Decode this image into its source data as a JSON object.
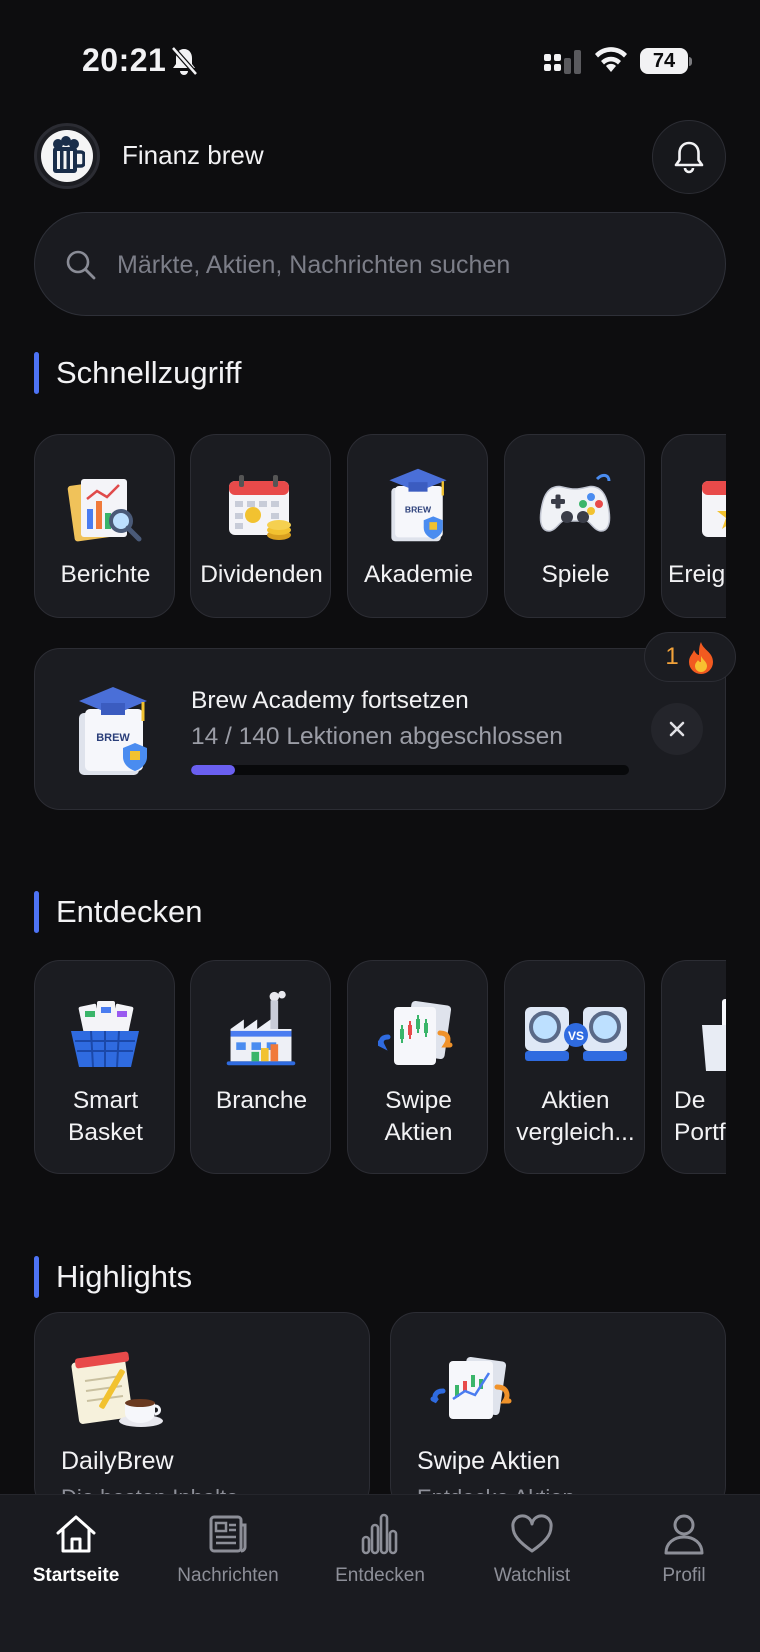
{
  "status_bar": {
    "time": "20:21",
    "battery": "74"
  },
  "header": {
    "app_name": "Finanz brew"
  },
  "search": {
    "placeholder": "Märkte, Aktien, Nachrichten suchen"
  },
  "quick_access": {
    "title": "Schnellzugriff",
    "items": [
      {
        "label": "Berichte",
        "icon": "report-icon"
      },
      {
        "label": "Dividenden",
        "icon": "dividend-calendar-icon"
      },
      {
        "label": "Akademie",
        "icon": "academy-icon"
      },
      {
        "label": "Spiele",
        "icon": "gamepad-icon"
      },
      {
        "label": "Ereig",
        "icon": "events-calendar-icon"
      }
    ]
  },
  "academy_card": {
    "title": "Brew Academy fortsetzen",
    "progress_text": "14 / 140 Lektionen abgeschlossen",
    "progress_fraction": 0.1,
    "streak": "1"
  },
  "discover": {
    "title": "Entdecken",
    "items": [
      {
        "line1": "Smart",
        "line2": "Basket",
        "icon": "smart-basket-icon"
      },
      {
        "line1": "Branche",
        "line2": "",
        "icon": "industry-icon"
      },
      {
        "line1": "Swipe",
        "line2": "Aktien",
        "icon": "swipe-stocks-icon"
      },
      {
        "line1": "Aktien",
        "line2": "vergleich...",
        "icon": "compare-stocks-icon"
      },
      {
        "line1": "De",
        "line2": "Portf",
        "icon": "portfolio-icon"
      }
    ]
  },
  "highlights": {
    "title": "Highlights",
    "cards": [
      {
        "title": "DailyBrew",
        "subtitle": "Die besten Inhalte",
        "icon": "daily-notes-icon"
      },
      {
        "title": "Swipe Aktien",
        "subtitle": "Entdecke Aktien",
        "icon": "swipe-stocks-icon"
      }
    ]
  },
  "bottom_nav": {
    "items": [
      {
        "label": "Startseite",
        "icon": "home-icon",
        "active": true
      },
      {
        "label": "Nachrichten",
        "icon": "newspaper-icon",
        "active": false
      },
      {
        "label": "Entdecken",
        "icon": "bar-chart-icon",
        "active": false
      },
      {
        "label": "Watchlist",
        "icon": "heart-icon",
        "active": false
      },
      {
        "label": "Profil",
        "icon": "person-icon",
        "active": false
      }
    ]
  },
  "colors": {
    "accent_blue": "#4d73f5",
    "progress": "#6a5ff0",
    "streak": "#f2a23a",
    "background": "#0d0d0f",
    "card": "#1b1c21"
  }
}
